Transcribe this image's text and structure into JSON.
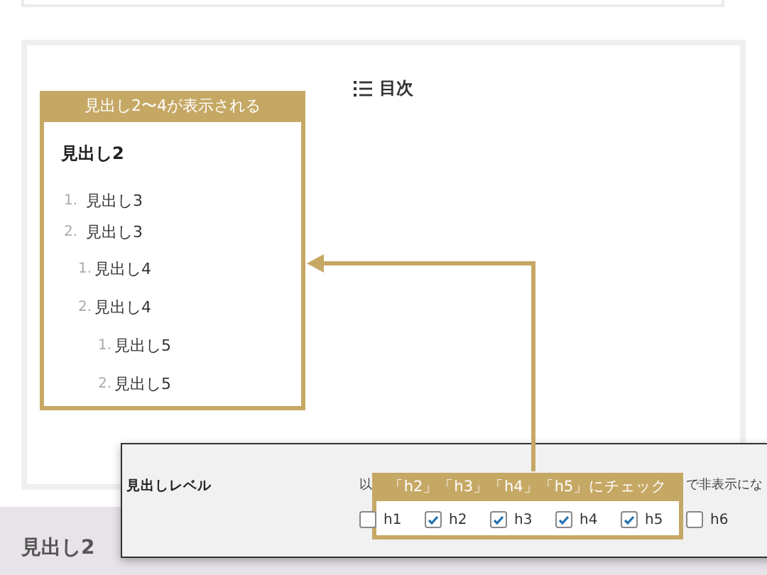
{
  "toc": {
    "title": "目次"
  },
  "annotation": {
    "caption": "見出し2〜4が表示される",
    "heading": "見出し2",
    "items": [
      {
        "number": "1.",
        "label": "見出し3"
      },
      {
        "number": "2.",
        "label": "見出し3",
        "children": [
          {
            "number": "1.",
            "label": "見出し4"
          },
          {
            "number": "2.",
            "label": "見出し4",
            "children": [
              {
                "number": "1.",
                "label": "見出し5"
              },
              {
                "number": "2.",
                "label": "見出し5"
              }
            ]
          }
        ]
      }
    ]
  },
  "settings_panel": {
    "label": "見出しレベル",
    "description_start": "以",
    "description_end": "で非表示にな",
    "callout": "「h2」「h3」「h4」「h5」にチェック",
    "options": [
      {
        "label": "h1",
        "checked": false
      },
      {
        "label": "h2",
        "checked": true
      },
      {
        "label": "h3",
        "checked": true
      },
      {
        "label": "h4",
        "checked": true
      },
      {
        "label": "h5",
        "checked": true
      },
      {
        "label": "h6",
        "checked": false
      }
    ]
  },
  "section_heading": "見出し2"
}
